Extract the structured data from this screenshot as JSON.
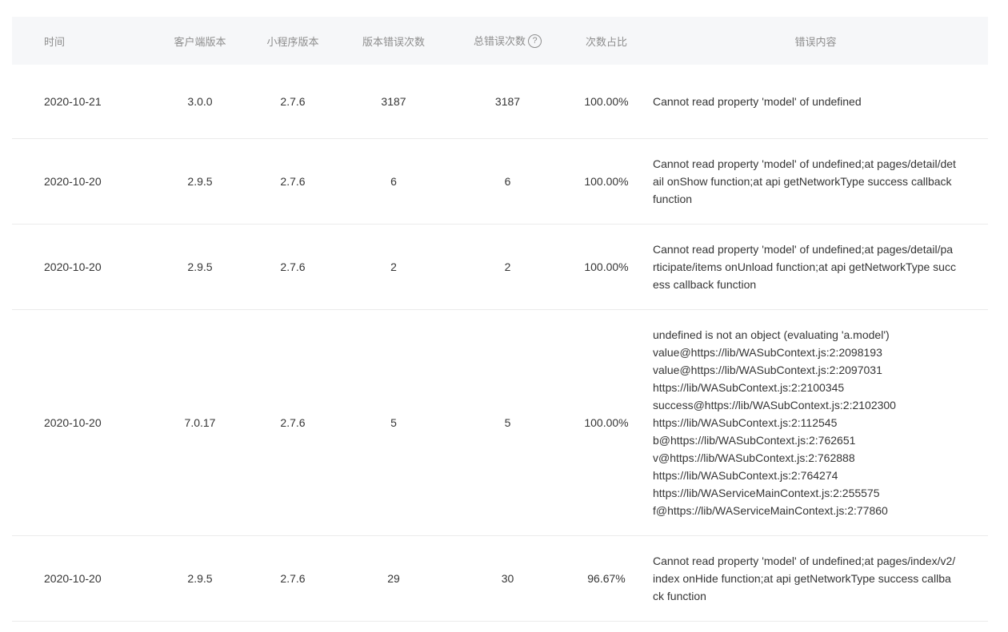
{
  "table": {
    "headers": {
      "time": "时间",
      "client_version": "客户端版本",
      "miniprogram_version": "小程序版本",
      "version_error_count": "版本错误次数",
      "total_error_count": "总错误次数",
      "help_icon": "?",
      "ratio": "次数占比",
      "error_content": "错误内容"
    },
    "rows": [
      {
        "time": "2020-10-21",
        "client_version": "3.0.0",
        "miniprogram_version": "2.7.6",
        "version_error_count": "3187",
        "total_error_count": "3187",
        "ratio": "100.00%",
        "error_content": "Cannot read property 'model' of undefined"
      },
      {
        "time": "2020-10-20",
        "client_version": "2.9.5",
        "miniprogram_version": "2.7.6",
        "version_error_count": "6",
        "total_error_count": "6",
        "ratio": "100.00%",
        "error_content": "Cannot read property 'model' of undefined;at pages/detail/detail onShow function;at api getNetworkType success callback function"
      },
      {
        "time": "2020-10-20",
        "client_version": "2.9.5",
        "miniprogram_version": "2.7.6",
        "version_error_count": "2",
        "total_error_count": "2",
        "ratio": "100.00%",
        "error_content": "Cannot read property 'model' of undefined;at pages/detail/participate/items onUnload function;at api getNetworkType success callback function"
      },
      {
        "time": "2020-10-20",
        "client_version": "7.0.17",
        "miniprogram_version": "2.7.6",
        "version_error_count": "5",
        "total_error_count": "5",
        "ratio": "100.00%",
        "error_content": "undefined is not an object (evaluating 'a.model')\nvalue@https://lib/WASubContext.js:2:2098193\nvalue@https://lib/WASubContext.js:2:2097031\nhttps://lib/WASubContext.js:2:2100345\nsuccess@https://lib/WASubContext.js:2:2102300\nhttps://lib/WASubContext.js:2:112545\nb@https://lib/WASubContext.js:2:762651\nv@https://lib/WASubContext.js:2:762888\nhttps://lib/WASubContext.js:2:764274\nhttps://lib/WAServiceMainContext.js:2:255575\nf@https://lib/WAServiceMainContext.js:2:77860"
      },
      {
        "time": "2020-10-20",
        "client_version": "2.9.5",
        "miniprogram_version": "2.7.6",
        "version_error_count": "29",
        "total_error_count": "30",
        "ratio": "96.67%",
        "error_content": "Cannot read property 'model' of undefined;at pages/index/v2/index onHide function;at api getNetworkType success callback function"
      }
    ]
  }
}
